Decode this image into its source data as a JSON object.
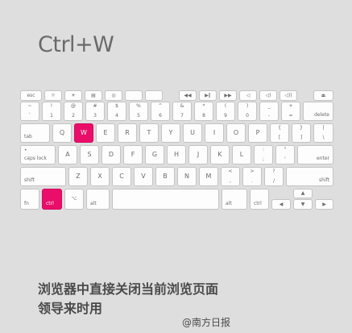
{
  "title": "Ctrl+W",
  "caption": {
    "line1": "浏览器中直接关闭当前浏览页面",
    "line2": "领导来时用"
  },
  "watermark": "@南方日报",
  "highlight_color": "#ea0e69",
  "keys": {
    "esc": "esc",
    "tilde_top": "~",
    "tilde_bot": "`",
    "n1_top": "!",
    "n1_bot": "1",
    "n2_top": "@",
    "n2_bot": "2",
    "n3_top": "#",
    "n3_bot": "3",
    "n4_top": "$",
    "n4_bot": "4",
    "n5_top": "%",
    "n5_bot": "5",
    "n6_top": "^",
    "n6_bot": "6",
    "n7_top": "&",
    "n7_bot": "7",
    "n8_top": "*",
    "n8_bot": "8",
    "n9_top": "(",
    "n9_bot": "9",
    "n0_top": ")",
    "n0_bot": "0",
    "minus_top": "_",
    "minus_bot": "-",
    "equal_top": "+",
    "equal_bot": "=",
    "delete": "delete",
    "tab": "tab",
    "q": "Q",
    "w": "W",
    "e": "E",
    "r": "R",
    "t": "T",
    "y": "Y",
    "u": "U",
    "i": "I",
    "o": "O",
    "p": "P",
    "lbr_top": "{",
    "lbr_bot": "[",
    "rbr_top": "}",
    "rbr_bot": "]",
    "bsl_top": "|",
    "bsl_bot": "\\",
    "caps": "caps lock",
    "a": "A",
    "s": "S",
    "d": "D",
    "f": "F",
    "g": "G",
    "h": "H",
    "j": "J",
    "k": "K",
    "l": "L",
    "semi_top": ":",
    "semi_bot": ";",
    "quote_top": "\"",
    "quote_bot": "'",
    "enter": "enter",
    "shift": "shift",
    "z": "Z",
    "x": "X",
    "c": "C",
    "v": "V",
    "b": "B",
    "n": "N",
    "m": "M",
    "comma_top": "<",
    "comma_bot": ",",
    "period_top": ">",
    "period_bot": ".",
    "slash_top": "?",
    "slash_bot": "/",
    "fn": "fn",
    "ctrl": "ctrl",
    "alt": "alt",
    "cmd": "⌘"
  }
}
